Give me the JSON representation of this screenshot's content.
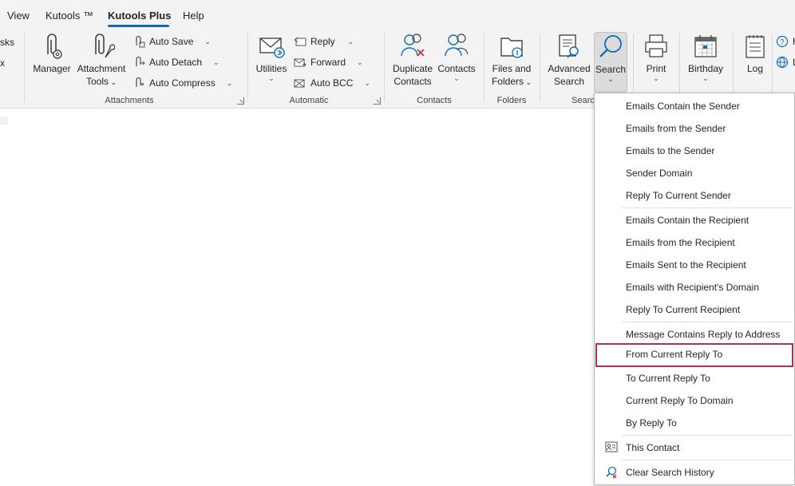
{
  "menubar": {
    "tabs": [
      {
        "label": "View"
      },
      {
        "label": "Kutools ™"
      },
      {
        "label": "Kutools Plus",
        "active": true
      },
      {
        "label": "Help"
      }
    ]
  },
  "ribbon": {
    "partial_left": [
      "sks",
      "x"
    ],
    "attachments": {
      "group_label": "Attachments",
      "manager_label": "Manager",
      "attachment_tools_label1": "Attachment",
      "attachment_tools_label2": "Tools",
      "auto_save": "Auto Save",
      "auto_detach": "Auto Detach",
      "auto_compress": "Auto Compress"
    },
    "automatic": {
      "group_label": "Automatic",
      "utilities_label": "Utilities",
      "reply": "Reply",
      "forward": "Forward",
      "auto_bcc": "Auto BCC"
    },
    "contacts": {
      "group_label": "Contacts",
      "duplicate_label1": "Duplicate",
      "duplicate_label2": "Contacts",
      "contacts_label": "Contacts"
    },
    "folders": {
      "group_label": "Folders",
      "files_label1": "Files and",
      "files_label2": "Folders"
    },
    "search": {
      "group_label": "Searc",
      "advanced_label1": "Advanced",
      "advanced_label2": "Search",
      "search_label": "Search"
    },
    "print_label": "Print",
    "birthday_label": "Birthday",
    "log_label": "Log",
    "partial_right": [
      "H",
      "L"
    ]
  },
  "menu": {
    "items": [
      {
        "label": "Emails Contain the Sender"
      },
      {
        "label": "Emails from the Sender"
      },
      {
        "label": "Emails to the Sender"
      },
      {
        "label": "Sender Domain"
      },
      {
        "label": "Reply To Current Sender"
      },
      {
        "label": "Emails Contain the Recipient"
      },
      {
        "label": "Emails from the Recipient"
      },
      {
        "label": "Emails Sent to the Recipient"
      },
      {
        "label": "Emails with Recipient's Domain"
      },
      {
        "label": "Reply To Current Recipient"
      },
      {
        "label": "Message Contains Reply to Address"
      },
      {
        "label": "From Current Reply To"
      },
      {
        "label": "To Current Reply To"
      },
      {
        "label": "Current Reply To Domain"
      },
      {
        "label": "By Reply To"
      },
      {
        "label": "This Contact"
      },
      {
        "label": "Clear Search History"
      }
    ]
  },
  "colors": {
    "accent": "#0f6cbd",
    "hover_border": "#a4374f",
    "ribbon_bg": "#f3f3f3"
  },
  "icons": {
    "manager": "paperclip-gear-icon",
    "attachment_tools": "paperclip-wrench-icon",
    "utilities": "envelope-icon",
    "duplicate_contacts": "contacts-x-icon",
    "contacts": "contacts-icon",
    "files_folders": "folder-icon",
    "advanced_search": "document-search-icon",
    "search": "magnifier-icon",
    "print": "printer-icon",
    "birthday": "calendar-icon",
    "log": "notepad-icon",
    "this_contact": "contact-card-icon",
    "clear_search": "magnifier-x-icon"
  }
}
